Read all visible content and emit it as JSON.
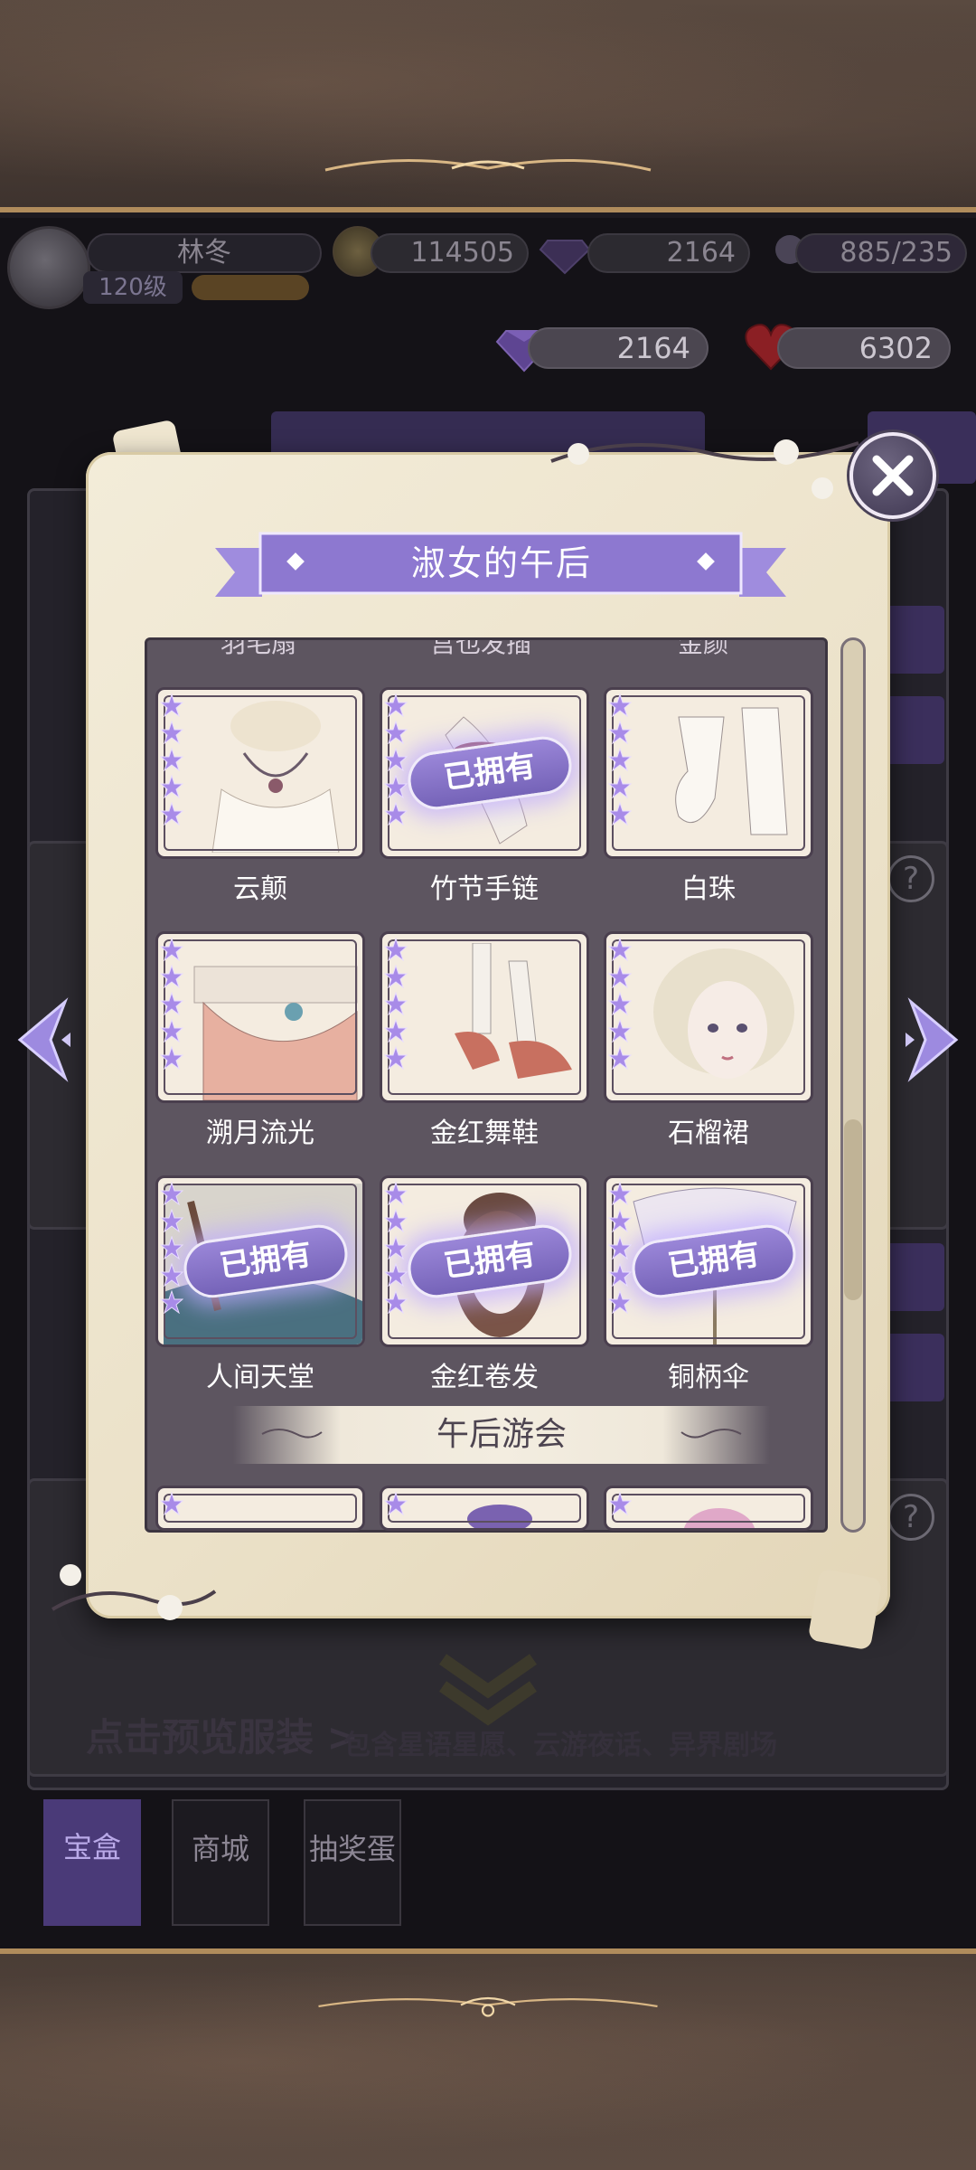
{
  "header": {
    "player_name": "林冬",
    "level": "120级",
    "coins": "114505",
    "gems_top": "2164",
    "stamina": "885/235",
    "gems": "2164",
    "hearts": "6302"
  },
  "background": {
    "preview_text": "点击预览服装 >",
    "description": "包含星语星愿、云游夜话、异界剧场"
  },
  "tabs": [
    {
      "label": "宝盒",
      "active": true
    },
    {
      "label": "商城",
      "active": false
    },
    {
      "label": "抽奖蛋",
      "active": false
    }
  ],
  "modal": {
    "title": "淑女的午后",
    "owned_label": "已拥有",
    "cutoff_items": [
      "羽毛扇",
      "宫也发插",
      "金颜"
    ],
    "items": [
      {
        "name": "云颠",
        "owned": false,
        "stars": 5
      },
      {
        "name": "竹节手链",
        "owned": true,
        "stars": 5
      },
      {
        "name": "白珠",
        "owned": false,
        "stars": 5
      },
      {
        "name": "溯月流光",
        "owned": false,
        "stars": 5
      },
      {
        "name": "金红舞鞋",
        "owned": false,
        "stars": 5
      },
      {
        "name": "石榴裙",
        "owned": false,
        "stars": 5
      },
      {
        "name": "人间天堂",
        "owned": true,
        "stars": 5
      },
      {
        "name": "金红卷发",
        "owned": true,
        "stars": 5
      },
      {
        "name": "铜柄伞",
        "owned": true,
        "stars": 5
      }
    ],
    "next_section": "午后游会"
  },
  "colors": {
    "accent_purple": "#8d78d0",
    "parchment": "#efe6d0",
    "list_bg": "#5d5560"
  }
}
